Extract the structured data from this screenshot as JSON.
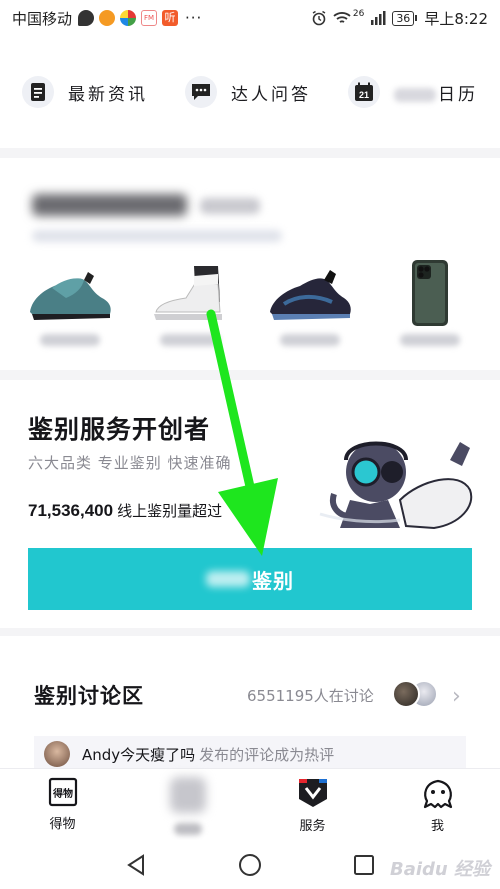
{
  "status_bar": {
    "carrier": "中国移动",
    "more": "···",
    "network": "26",
    "battery": "36",
    "time": "早上8:22",
    "app3_text": "FM",
    "app4_text": "听"
  },
  "quick_nav": [
    {
      "label": "最新资讯",
      "icon": "document-icon"
    },
    {
      "label": "达人问答",
      "icon": "chat-icon"
    },
    {
      "label": "日历",
      "icon": "calendar-icon",
      "calendar_day": "21"
    }
  ],
  "hero": {
    "title": "鉴别服务开创者",
    "subtitle": "六大品类 专业鉴别 快速准确",
    "stat_number": "71,536,400",
    "stat_text": "线上鉴别量超过",
    "cta_label": "鉴别"
  },
  "discussion": {
    "title": "鉴别讨论区",
    "count_text": "6551195人在讨论",
    "comment_user": "Andy今天瘦了吗",
    "comment_text": "发布的评论成为热评"
  },
  "tab_bar": [
    {
      "label": "得物",
      "icon": "dewu-logo-icon"
    },
    {
      "label": "",
      "icon": "blurred-icon"
    },
    {
      "label": "服务",
      "icon": "service-icon"
    },
    {
      "label": "我",
      "icon": "profile-icon"
    }
  ],
  "colors": {
    "accent": "#21c7cf",
    "annotation_arrow": "#1ee61e",
    "service_red": "#e5262e"
  },
  "watermark": "Baidu 经验"
}
